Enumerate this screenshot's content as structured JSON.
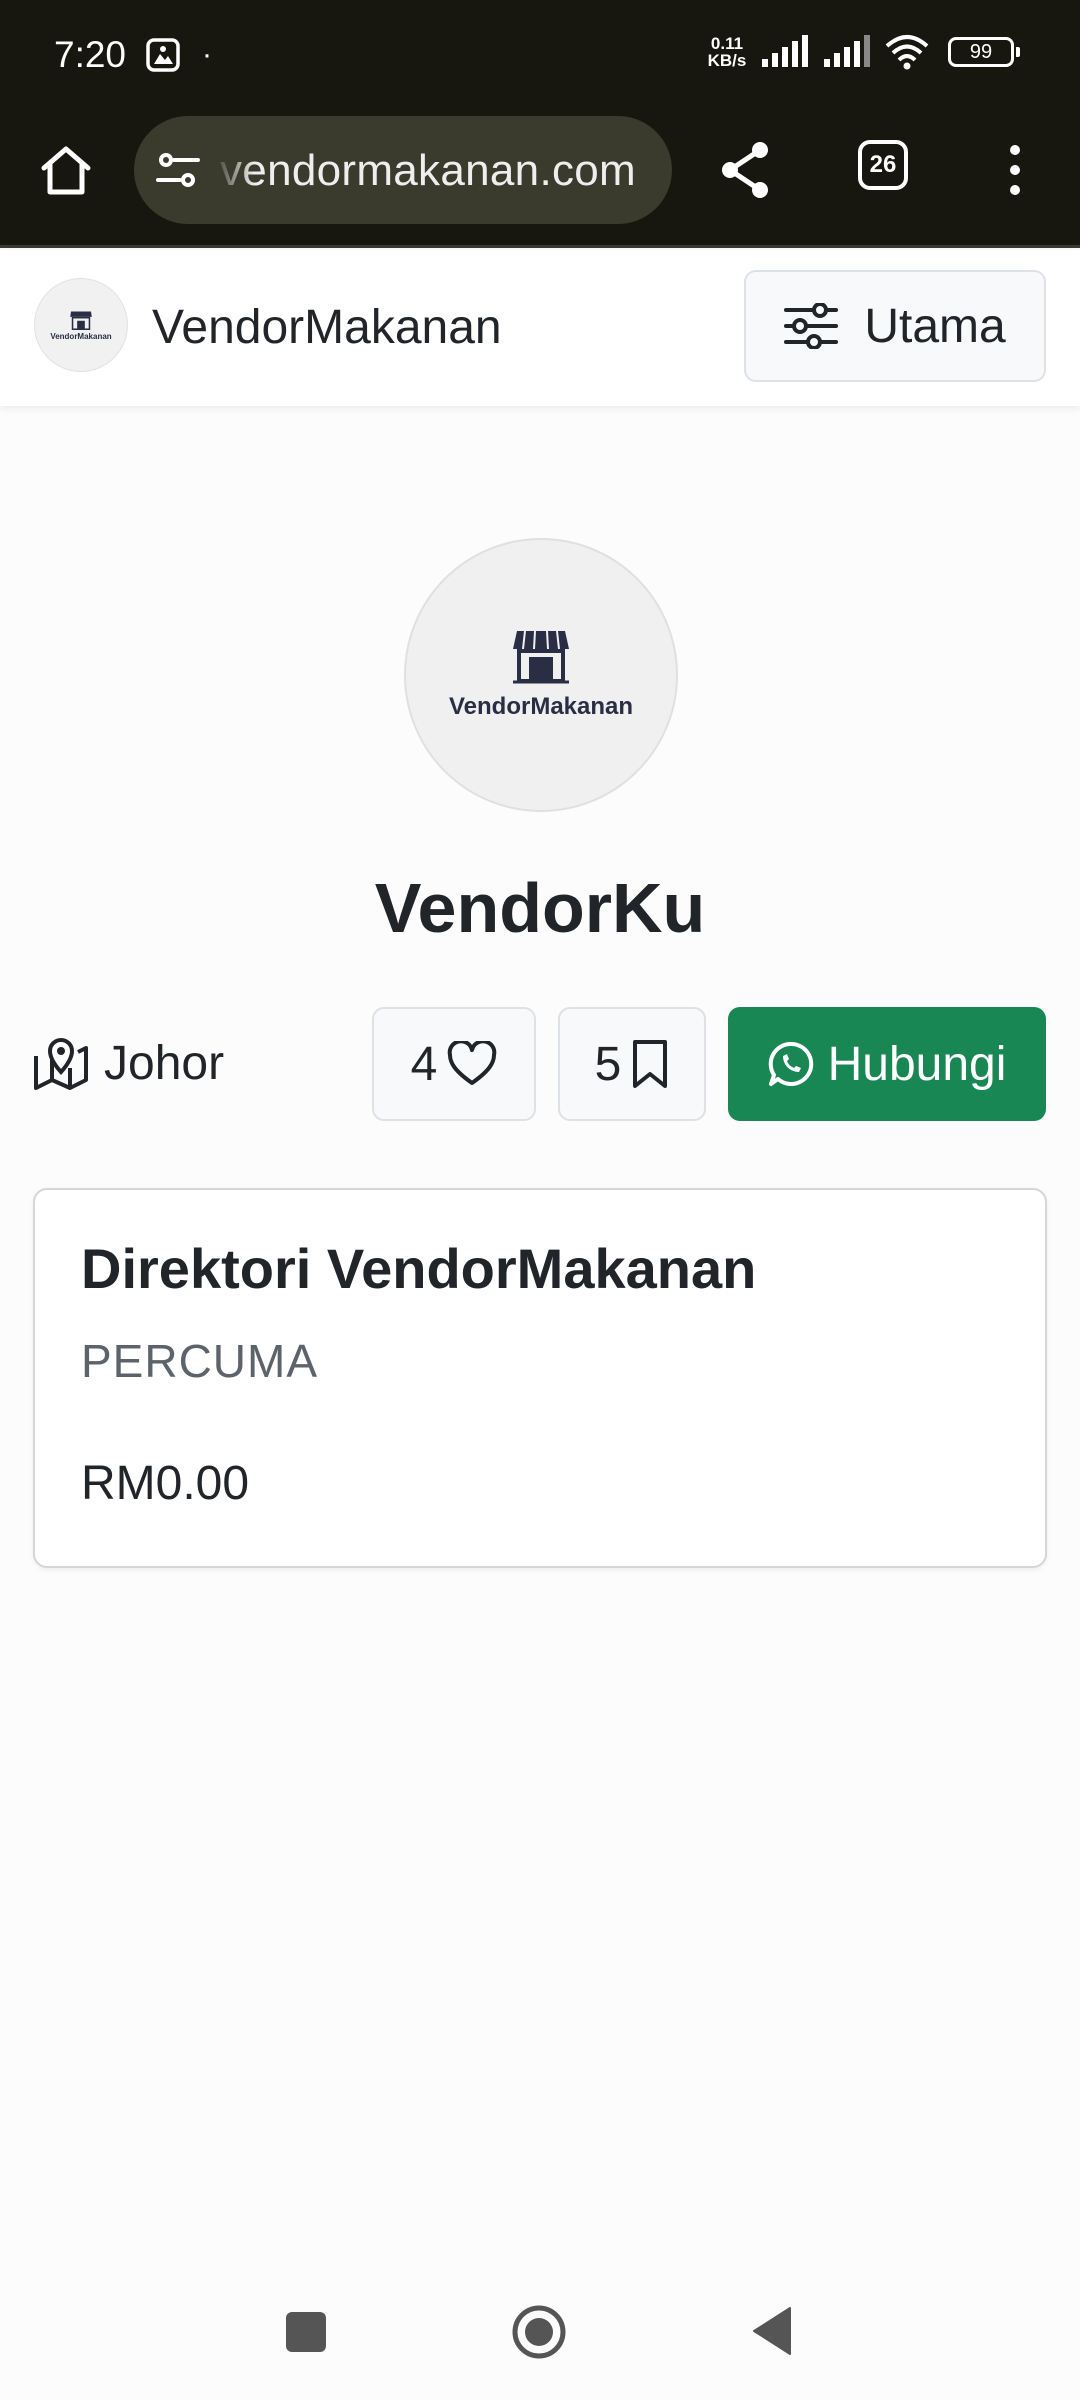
{
  "status_bar": {
    "time": "7:20",
    "dot": "·",
    "net_speed_value": "0.11",
    "net_speed_unit": "KB/s",
    "battery": "99"
  },
  "browser": {
    "url": "vendormakanan.com",
    "tab_count": "26"
  },
  "header": {
    "brand_name": "VendorMakanan",
    "logo_text": "VendorMakanan",
    "menu_label": "Utama"
  },
  "profile": {
    "avatar_text": "VendorMakanan",
    "name": "VendorKu",
    "location": "Johor",
    "likes": "4",
    "saves": "5",
    "contact_label": "Hubungi"
  },
  "card": {
    "title": "Direktori VendorMakanan",
    "subtitle": "PERCUMA",
    "price": "RM0.00"
  },
  "colors": {
    "accent_green": "#198754",
    "text_dark": "#212529",
    "toolbar_bg": "#17170f"
  }
}
